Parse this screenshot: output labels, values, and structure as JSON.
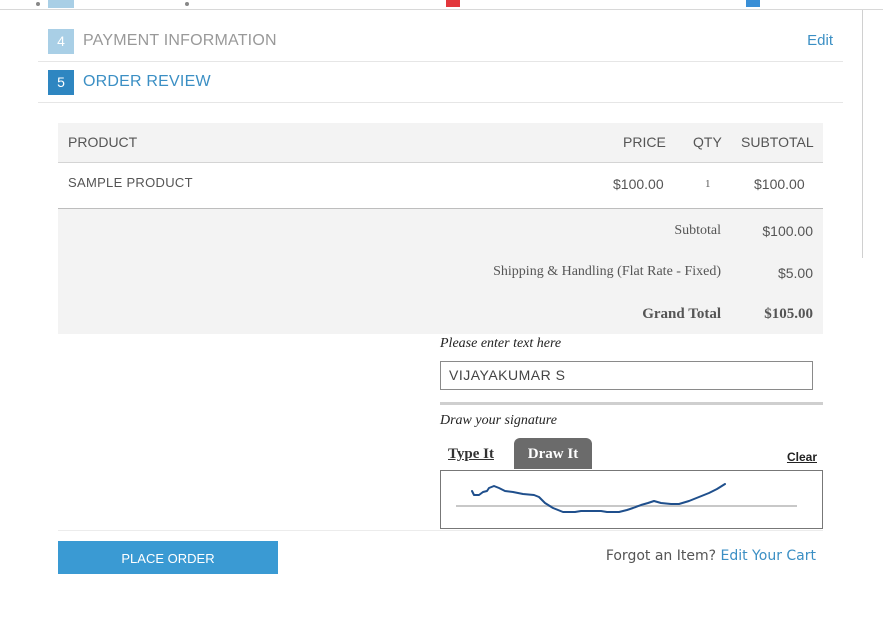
{
  "steps": [
    {
      "number": "4",
      "label": "PAYMENT INFORMATION",
      "edit": "Edit",
      "color": "#a9cfe6",
      "text_color": "#999999"
    },
    {
      "number": "5",
      "label": "ORDER REVIEW",
      "color": "#2e86c1",
      "text_color": "#3b8fc4"
    }
  ],
  "table": {
    "headers": {
      "product": "PRODUCT",
      "price": "PRICE",
      "qty": "QTY",
      "subtotal": "SUBTOTAL"
    },
    "rows": [
      {
        "product": "SAMPLE PRODUCT",
        "price": "$100.00",
        "qty": "1",
        "subtotal": "$100.00"
      }
    ],
    "totals": {
      "subtotal_label": "Subtotal",
      "subtotal_value": "$100.00",
      "shipping_label": "Shipping & Handling (Flat Rate - Fixed)",
      "shipping_value": "$5.00",
      "grand_label": "Grand Total",
      "grand_value": "$105.00"
    }
  },
  "signature": {
    "text_prompt": "Please enter text here",
    "text_value": "VIJAYAKUMAR S",
    "draw_prompt": "Draw your signature",
    "tab_type": "Type It",
    "tab_draw": "Draw It",
    "clear": "Clear"
  },
  "footer": {
    "place_order": "PLACE ORDER",
    "forgot": "Forgot an Item?",
    "edit_cart": "Edit Your Cart"
  },
  "colors": {
    "accent": "#3a9ad3",
    "link": "#3b8fc4",
    "panel": "#f3f3f3"
  }
}
